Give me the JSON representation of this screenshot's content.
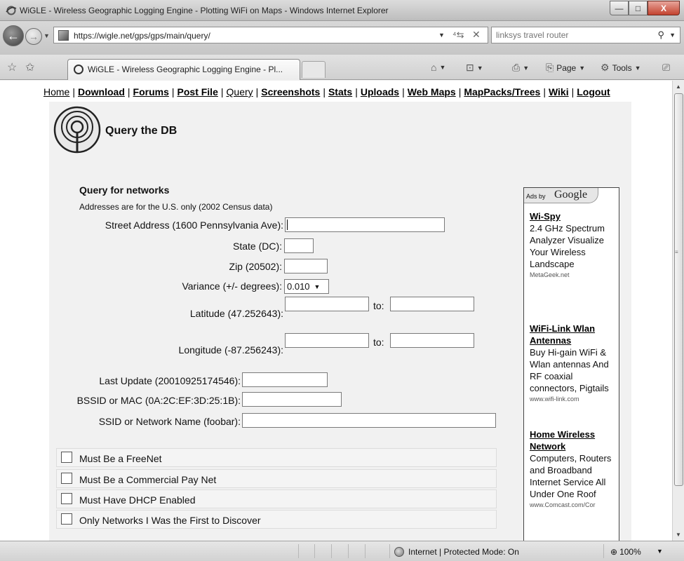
{
  "window": {
    "title": "WiGLE - Wireless Geographic Logging Engine - Plotting WiFi on Maps - Windows Internet Explorer",
    "minimize": "—",
    "maximize": "□",
    "close": "X"
  },
  "nav": {
    "url": "https://wigle.net/gps/gps/main/query/",
    "search_placeholder": "linksys travel router"
  },
  "tab": {
    "title": "WiGLE - Wireless Geographic Logging Engine - Pl..."
  },
  "commands": {
    "page": "Page",
    "tools": "Tools"
  },
  "topnav": [
    {
      "label": "Home",
      "bold": false
    },
    {
      "label": "Download",
      "bold": true
    },
    {
      "label": "Forums",
      "bold": true
    },
    {
      "label": "Post File",
      "bold": true
    },
    {
      "label": "Query",
      "bold": false
    },
    {
      "label": "Screenshots",
      "bold": true
    },
    {
      "label": "Stats",
      "bold": true
    },
    {
      "label": "Uploads",
      "bold": true
    },
    {
      "label": "Web Maps",
      "bold": true
    },
    {
      "label": "MapPacks/Trees",
      "bold": true
    },
    {
      "label": "Wiki",
      "bold": true
    },
    {
      "label": "Logout",
      "bold": true
    }
  ],
  "page": {
    "title": "Query the DB",
    "section_title": "Query for networks",
    "section_note": "Addresses are for the U.S. only (2002 Census data)"
  },
  "form": {
    "street_label": "Street Address (1600 Pennsylvania Ave):",
    "state_label": "State (DC):",
    "zip_label": "Zip (20502):",
    "variance_label": "Variance (+/- degrees):",
    "variance_value": "0.010",
    "latitude_label": "Latitude (47.252643):",
    "longitude_label": "Longitude (-87.256243):",
    "to_label": "to:",
    "last_update_label": "Last Update (20010925174546):",
    "bssid_label": "BSSID or MAC (0A:2C:EF:3D:25:1B):",
    "ssid_label": "SSID or Network Name (foobar):"
  },
  "checkboxes": [
    {
      "label": "Must Be a FreeNet",
      "checked": false
    },
    {
      "label": "Must Be a Commercial Pay Net",
      "checked": false
    },
    {
      "label": "Must Have DHCP Enabled",
      "checked": false
    },
    {
      "label": "Only Networks I Was the First to Discover",
      "checked": false
    }
  ],
  "ads": {
    "ads_by": "Ads by",
    "brand": "Google",
    "items": [
      {
        "title": "Wi-Spy",
        "body": "2.4 GHz Spectrum Analyzer Visualize Your Wireless Landscape",
        "url": "MetaGeek.net"
      },
      {
        "title": "WiFi-Link Wlan Antennas",
        "body": "Buy Hi-gain WiFi & Wlan antennas And RF coaxial connectors, Pigtails",
        "url": "www.wifi-link.com"
      },
      {
        "title": "Home Wireless Network",
        "body": "Computers, Routers and Broadband Internet Service All Under One Roof",
        "url": "www.Comcast.com/Cor"
      }
    ]
  },
  "status": {
    "zone": "Internet | Protected Mode: On",
    "zoom": "100%"
  }
}
